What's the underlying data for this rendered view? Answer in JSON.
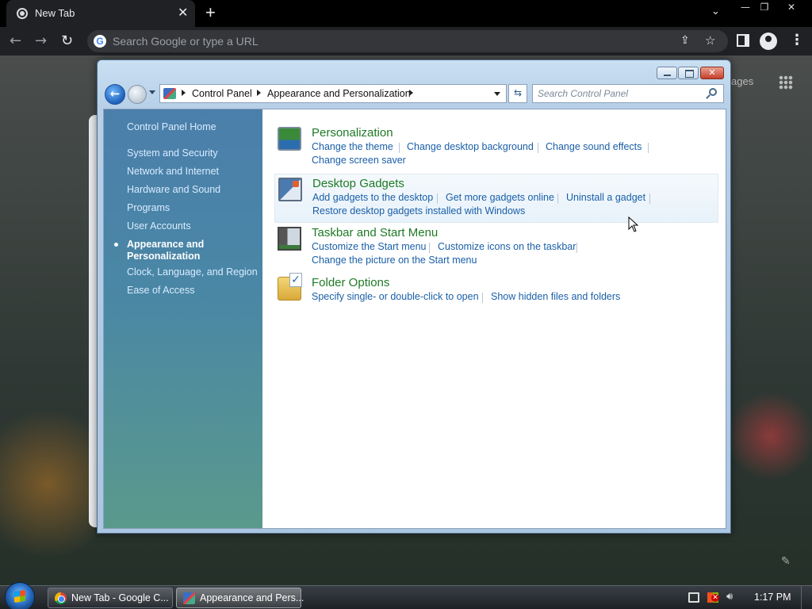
{
  "browser": {
    "tab_title": "New Tab",
    "omnibox_placeholder": "Search Google or type a URL",
    "images_link": "ages"
  },
  "window": {
    "breadcrumb": [
      "Control Panel",
      "Appearance and Personalization"
    ],
    "search_placeholder": "Search Control Panel"
  },
  "nav": {
    "home": "Control Panel Home",
    "items": [
      "System and Security",
      "Network and Internet",
      "Hardware and Sound",
      "Programs",
      "User Accounts"
    ],
    "current": "Appearance and Personalization",
    "items_after": [
      "Clock, Language, and Region",
      "Ease of Access"
    ]
  },
  "groups": [
    {
      "title": "Personalization",
      "icon": "personalization-icon",
      "links": [
        "Change the theme",
        "Change desktop background",
        "Change sound effects",
        "Change screen saver"
      ]
    },
    {
      "title": "Desktop Gadgets",
      "icon": "gadgets-icon",
      "links": [
        "Add gadgets to the desktop",
        "Get more gadgets online",
        "Uninstall a gadget",
        "Restore desktop gadgets installed with Windows"
      ]
    },
    {
      "title": "Taskbar and Start Menu",
      "icon": "taskbar-icon",
      "links": [
        "Customize the Start menu",
        "Customize icons on the taskbar",
        "Change the picture on the Start menu"
      ]
    },
    {
      "title": "Folder Options",
      "icon": "folder-options-icon",
      "links": [
        "Specify single- or double-click to open",
        "Show hidden files and folders"
      ]
    }
  ],
  "taskbar": {
    "buttons": [
      "New Tab - Google C...",
      "Appearance and Pers..."
    ],
    "clock": "1:17 PM"
  },
  "colors": {
    "link": "#1a5fa8",
    "group_title": "#1e7a26",
    "nav_gradient_top": "#4b7fab",
    "nav_gradient_bottom": "#5a9a8c"
  }
}
